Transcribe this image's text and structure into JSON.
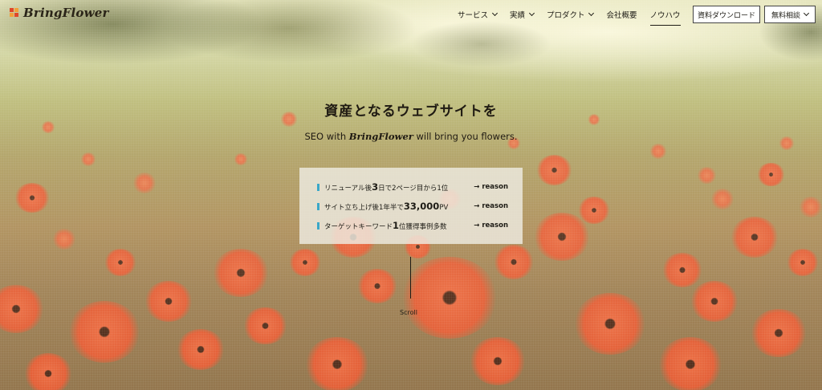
{
  "brand": {
    "name": "BringFlower"
  },
  "nav": {
    "items": [
      {
        "label": "サービス",
        "has_dropdown": true
      },
      {
        "label": "実績",
        "has_dropdown": true
      },
      {
        "label": "プロダクト",
        "has_dropdown": true
      },
      {
        "label": "会社概要",
        "has_dropdown": false
      },
      {
        "label": "ノウハウ",
        "has_dropdown": false,
        "active": true
      }
    ],
    "social_icon": "x-icon",
    "download_button": "資料ダウンロード",
    "consult_button": "無料相談"
  },
  "hero": {
    "headline": "資産となるウェブサイトを",
    "tagline_prefix": "SEO with ",
    "tagline_brand": "BringFlower",
    "tagline_suffix": " will bring you flowers."
  },
  "reasons": [
    {
      "pre": "リニューアル後",
      "strong": "3",
      "post": "日で2ページ目から1位",
      "link": "→ reason"
    },
    {
      "pre": "サイト立ち上げ後1年半で",
      "strong": "33,000",
      "post": "PV",
      "link": "→ reason"
    },
    {
      "pre": "ターゲットキーワード",
      "strong": "1",
      "post": "位獲得事例多数",
      "link": "→ reason"
    }
  ],
  "scroll": {
    "label": "Scroll"
  },
  "colors": {
    "accent_bar": "#3aa8c8",
    "logo_red": "#e0472a",
    "logo_orange": "#f2a03a"
  }
}
